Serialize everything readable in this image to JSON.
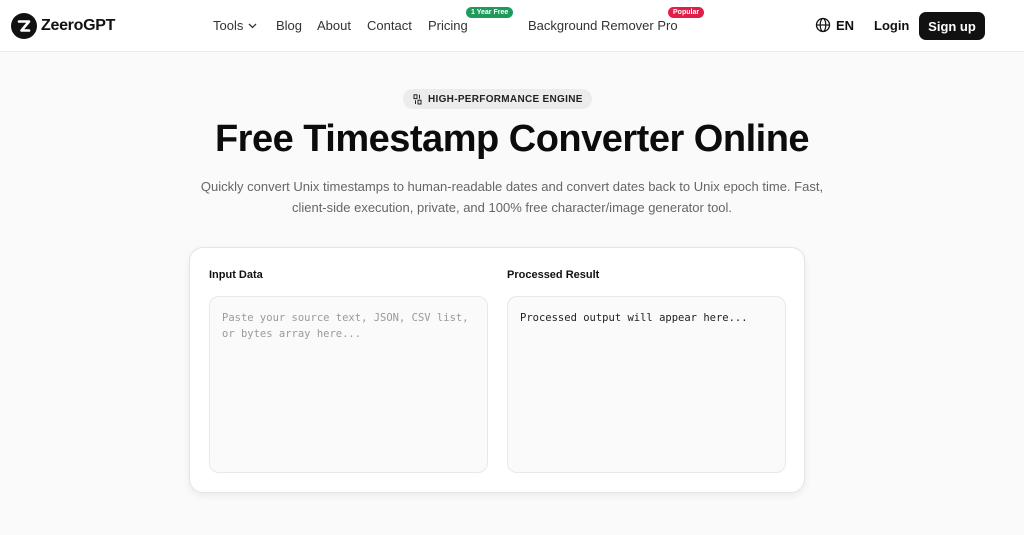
{
  "brand": {
    "name": "ZeeroGPT"
  },
  "nav": {
    "tools": "Tools",
    "blog": "Blog",
    "about": "About",
    "contact": "Contact",
    "pricing": "Pricing",
    "pricing_badge": "1 Year Free",
    "bg_remover": "Background Remover Pro",
    "bg_remover_badge": "Popular"
  },
  "header": {
    "language": "EN",
    "login": "Login",
    "signup": "Sign up"
  },
  "hero": {
    "badge": "HIGH-PERFORMANCE ENGINE",
    "title": "Free Timestamp Converter Online",
    "subtitle": "Quickly convert Unix timestamps to human-readable dates and convert dates back to Unix epoch time. Fast, client-side execution, private, and 100% free character/image generator tool."
  },
  "tool": {
    "input_label": "Input Data",
    "input_placeholder": "Paste your source text, JSON, CSV list, or bytes array here...",
    "input_value": "",
    "output_label": "Processed Result",
    "output_text": "Processed output will appear here..."
  },
  "colors": {
    "primary": "#111111",
    "pricing_badge": "#1f9a5b",
    "popular_badge": "#e11d48",
    "muted_text": "#666666"
  },
  "icons": {
    "logo": "z-logo-icon",
    "tools_menu": "chevron-down-icon",
    "language": "globe-icon",
    "badge": "sort-numbers-icon"
  }
}
